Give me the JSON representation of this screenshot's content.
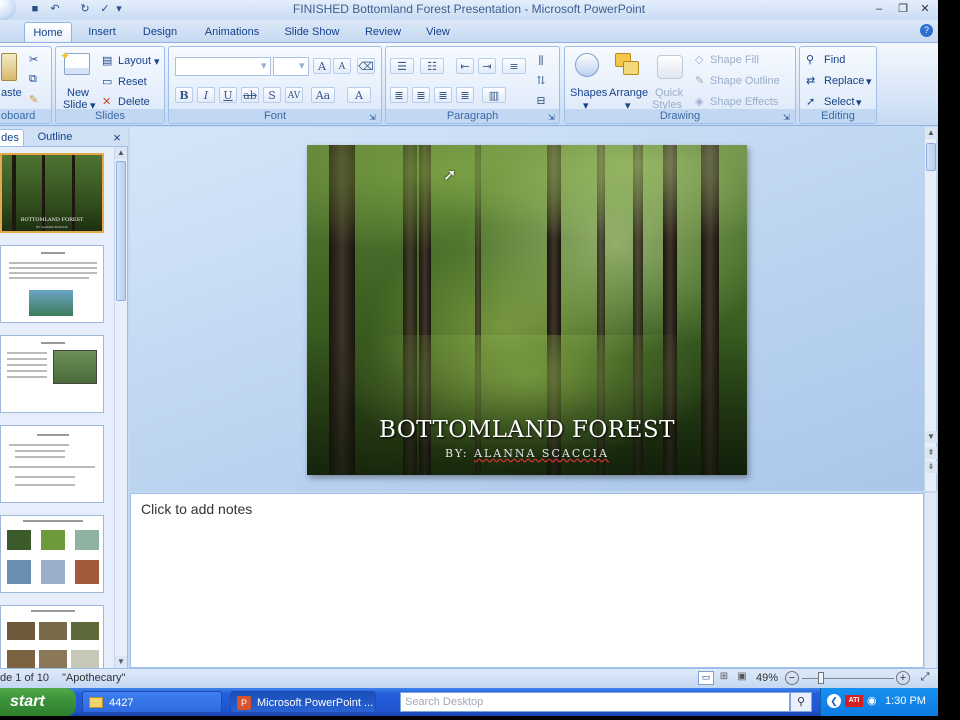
{
  "window": {
    "title": "FINISHED Bottomland Forest Presentation - Microsoft PowerPoint"
  },
  "tabs": [
    "Home",
    "Insert",
    "Design",
    "Animations",
    "Slide Show",
    "Review",
    "View"
  ],
  "ribbon": {
    "clipboard": {
      "paste": "aste",
      "label": "oboard"
    },
    "slides": {
      "new_slide_1": "New",
      "new_slide_2": "Slide",
      "layout": "Layout",
      "reset": "Reset",
      "delete": "Delete",
      "label": "Slides"
    },
    "font": {
      "label": "Font",
      "font_name": "",
      "font_size": ""
    },
    "paragraph": {
      "label": "Paragraph"
    },
    "drawing": {
      "shapes": "Shapes",
      "arrange": "Arrange",
      "quick_styles_1": "Quick",
      "quick_styles_2": "Styles",
      "shape_fill": "Shape Fill",
      "shape_outline": "Shape Outline",
      "shape_effects": "Shape Effects",
      "label": "Drawing"
    },
    "editing": {
      "find": "Find",
      "replace": "Replace",
      "select": "Select",
      "label": "Editing"
    }
  },
  "pane": {
    "tab_slides": "des",
    "tab_outline": "Outline",
    "close": "×",
    "thumb1_title": "BOTTOMLAND FOREST",
    "thumb1_sub": "BY: ALANNA SCACCIA"
  },
  "slide": {
    "title": "BOTTOMLAND FOREST",
    "subtitle_prefix": "BY: ",
    "subtitle_name": "ALANNA SCACCIA"
  },
  "notes": {
    "placeholder": "Click to add notes"
  },
  "status": {
    "slide_count": "de 1 of 10",
    "theme": "\"Apothecary\"",
    "zoom": "49%"
  },
  "taskbar": {
    "start": "start",
    "folder": "4427",
    "ppt": "Microsoft PowerPoint ...",
    "search_placeholder": "Search Desktop",
    "clock": "1:30 PM"
  }
}
